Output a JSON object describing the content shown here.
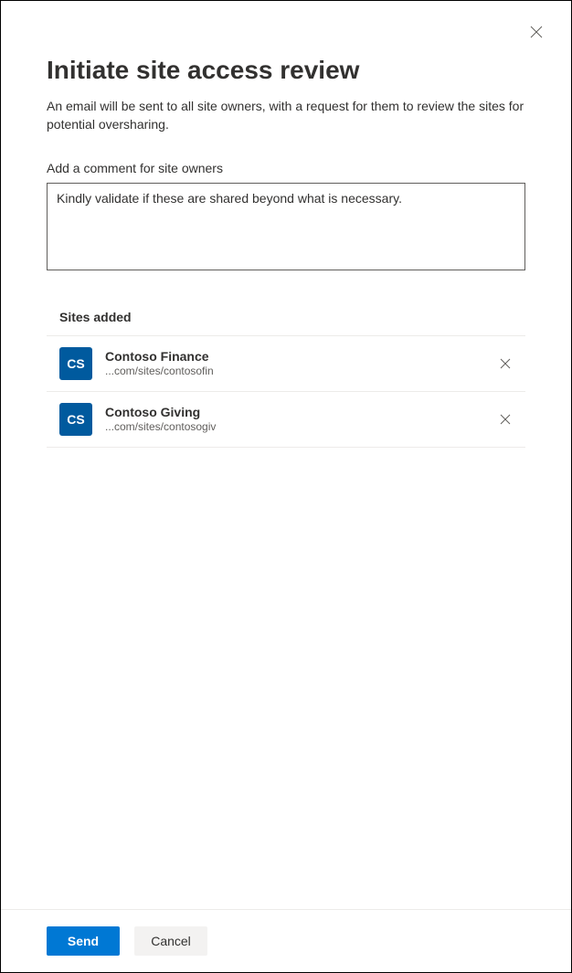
{
  "dialog": {
    "title": "Initiate site access review",
    "description": "An email will be sent to all site owners, with a request for them to review the sites for potential oversharing.",
    "comment_label": "Add a comment for site owners",
    "comment_value": "Kindly validate if these are shared beyond what is necessary."
  },
  "sites": {
    "heading": "Sites added",
    "items": [
      {
        "initials": "CS",
        "name": "Contoso Finance",
        "url": "...com/sites/contosofin"
      },
      {
        "initials": "CS",
        "name": "Contoso Giving",
        "url": "...com/sites/contosogiv"
      }
    ]
  },
  "footer": {
    "send_label": "Send",
    "cancel_label": "Cancel"
  }
}
